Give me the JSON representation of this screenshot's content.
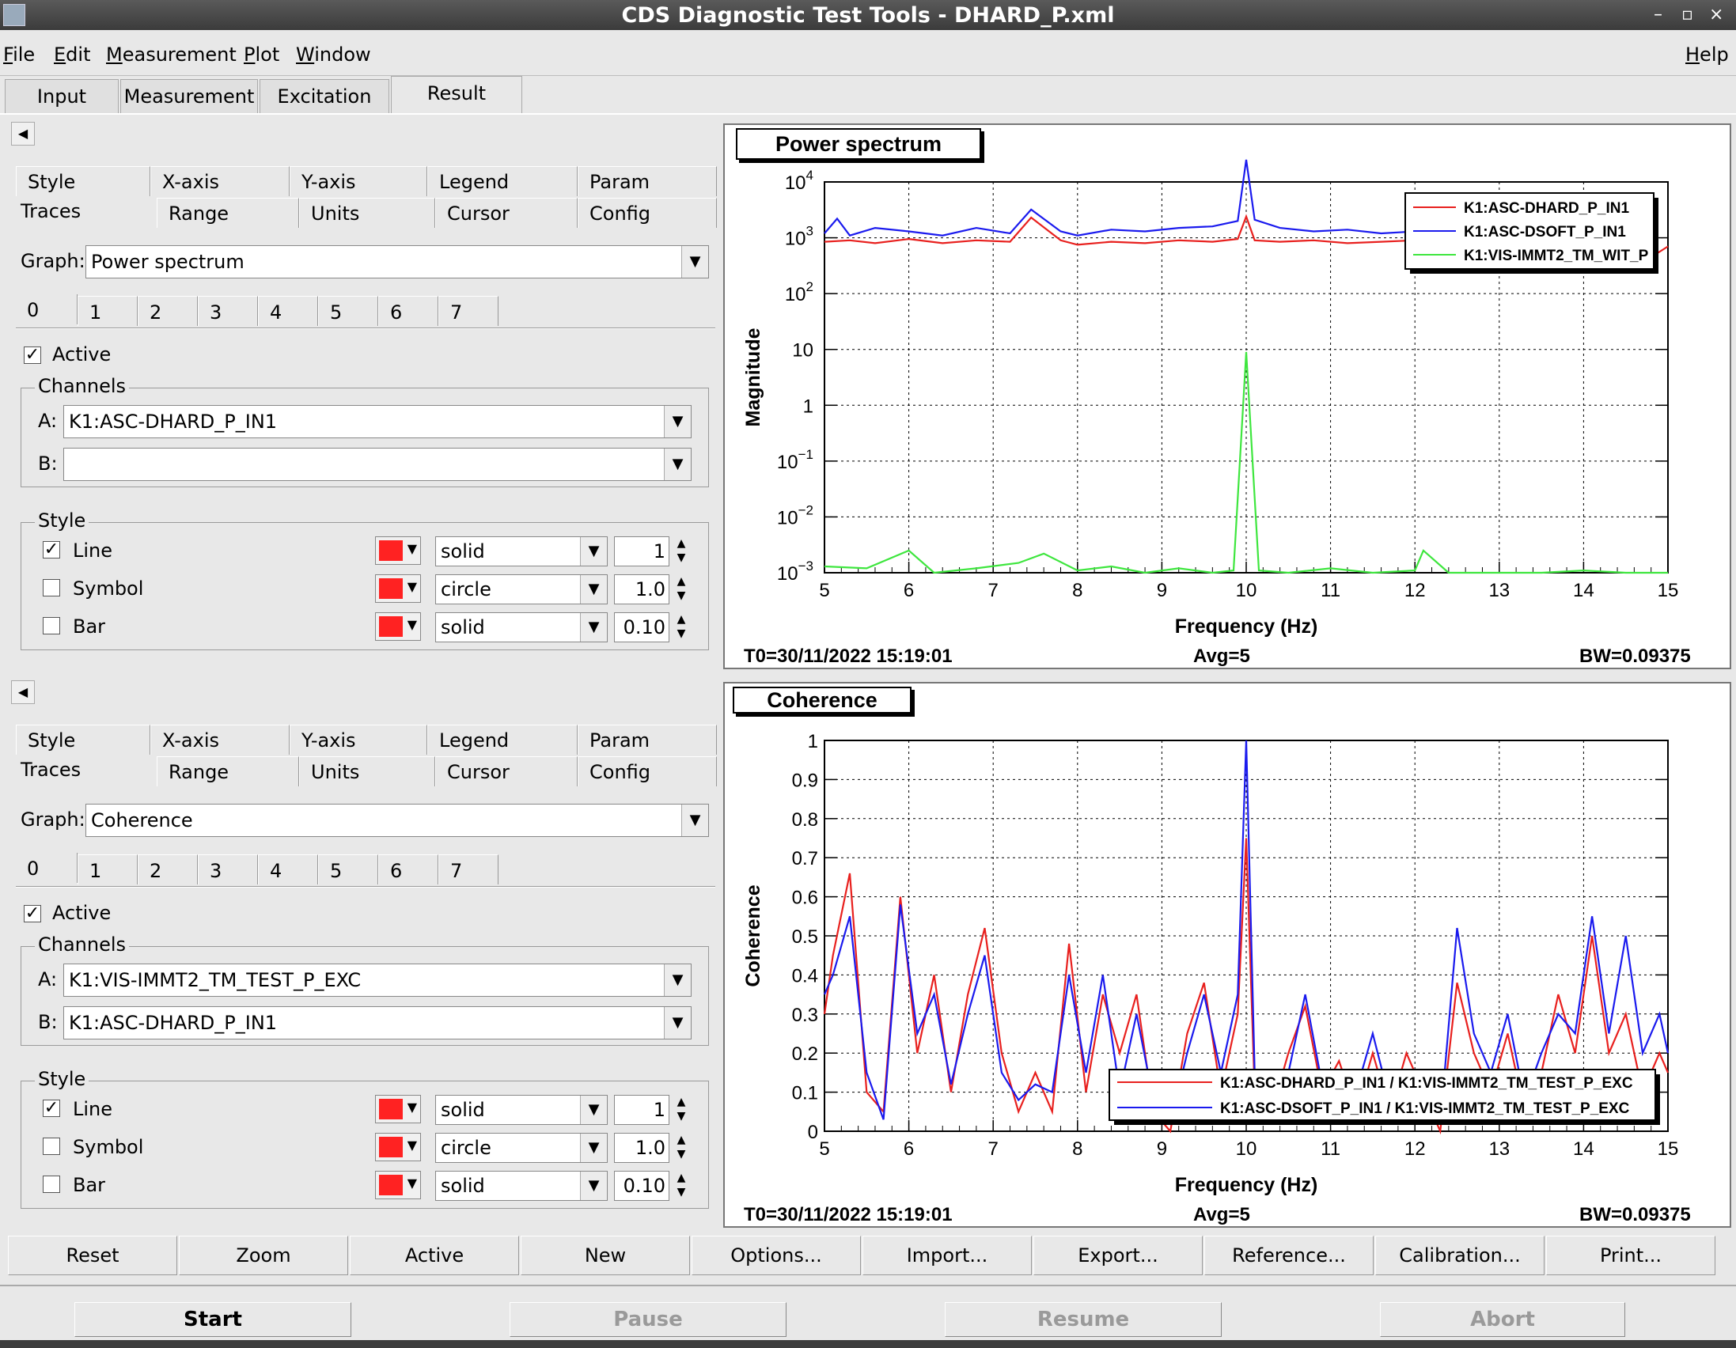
{
  "window": {
    "title": "CDS Diagnostic Test Tools - DHARD_P.xml",
    "controls": [
      "–",
      "▫",
      "×"
    ]
  },
  "menu": {
    "file": {
      "u": "F",
      "rest": "ile"
    },
    "edit": {
      "u": "E",
      "rest": "dit"
    },
    "measurement": {
      "u": "M",
      "rest": "easurement"
    },
    "plot": {
      "u": "P",
      "rest": "lot"
    },
    "window": {
      "u": "W",
      "rest": "indow"
    },
    "help": {
      "u": "H",
      "rest": "elp"
    }
  },
  "top_tabs": [
    "Input",
    "Measurement",
    "Excitation",
    "Result"
  ],
  "panels": [
    {
      "subtabs_row1": [
        "Style",
        "X-axis",
        "Y-axis",
        "Legend",
        "Param"
      ],
      "subtabs_row2": [
        "Traces",
        "Range",
        "Units",
        "Cursor",
        "Config"
      ],
      "graph_label": "Graph:",
      "graph_value": "Power spectrum",
      "trace_tabs": [
        "0",
        "1",
        "2",
        "3",
        "4",
        "5",
        "6",
        "7"
      ],
      "active_label": "Active",
      "channels_title": "Channels",
      "channel_a_label": "A:",
      "channel_a": "K1:ASC-DHARD_P_IN1",
      "channel_b_label": "B:",
      "channel_b": "",
      "style_title": "Style",
      "line_label": "Line",
      "line_style": "solid",
      "line_width": "1",
      "symbol_label": "Symbol",
      "symbol_style": "circle",
      "symbol_size": "1.0",
      "bar_label": "Bar",
      "bar_style": "solid",
      "bar_width": "0.10"
    },
    {
      "subtabs_row1": [
        "Style",
        "X-axis",
        "Y-axis",
        "Legend",
        "Param"
      ],
      "subtabs_row2": [
        "Traces",
        "Range",
        "Units",
        "Cursor",
        "Config"
      ],
      "graph_label": "Graph:",
      "graph_value": "Coherence",
      "trace_tabs": [
        "0",
        "1",
        "2",
        "3",
        "4",
        "5",
        "6",
        "7"
      ],
      "active_label": "Active",
      "channels_title": "Channels",
      "channel_a_label": "A:",
      "channel_a": "K1:VIS-IMMT2_TM_TEST_P_EXC",
      "channel_b_label": "B:",
      "channel_b": "K1:ASC-DHARD_P_IN1",
      "style_title": "Style",
      "line_label": "Line",
      "line_style": "solid",
      "line_width": "1",
      "symbol_label": "Symbol",
      "symbol_style": "circle",
      "symbol_size": "1.0",
      "bar_label": "Bar",
      "bar_style": "solid",
      "bar_width": "0.10"
    }
  ],
  "plots": [
    {
      "title": "Power spectrum",
      "footer_t0": "T0=30/11/2022 15:19:01",
      "footer_avg": "Avg=5",
      "footer_bw": "BW=0.09375"
    },
    {
      "title": "Coherence",
      "footer_t0": "T0=30/11/2022 15:19:01",
      "footer_avg": "Avg=5",
      "footer_bw": "BW=0.09375"
    }
  ],
  "chart_data": [
    {
      "type": "line",
      "title": "Power spectrum",
      "xlabel": "Frequency (Hz)",
      "ylabel": "Magnitude",
      "xlim": [
        5,
        15
      ],
      "ylim": [
        0.001,
        10000
      ],
      "yscale": "log",
      "grid": true,
      "legend_position": "top-right",
      "x_ticks": [
        "5",
        "6",
        "7",
        "8",
        "9",
        "10",
        "11",
        "12",
        "13",
        "14",
        "15"
      ],
      "y_ticks": [
        {
          "value": 10000,
          "base": "10",
          "exp": "4"
        },
        {
          "value": 1000,
          "base": "10",
          "exp": "3"
        },
        {
          "value": 100,
          "base": "10",
          "exp": "2"
        },
        {
          "value": 10,
          "base": "10",
          "exp": ""
        },
        {
          "value": 1,
          "base": "1",
          "exp": ""
        },
        {
          "value": 0.1,
          "base": "10",
          "exp": "−1"
        },
        {
          "value": 0.01,
          "base": "10",
          "exp": "−2"
        },
        {
          "value": 0.001,
          "base": "10",
          "exp": "−3"
        }
      ],
      "series": [
        {
          "name": "K1:ASC-DHARD_P_IN1",
          "color": "#e8201e",
          "x": [
            5,
            5.3,
            5.6,
            6,
            6.4,
            6.8,
            7.2,
            7.45,
            7.8,
            8,
            8.4,
            8.8,
            9.2,
            9.6,
            9.9,
            10,
            10.1,
            10.4,
            10.8,
            11.2,
            11.6,
            12,
            12.4,
            12.8,
            13.2,
            13.6,
            14,
            14.4,
            14.8,
            15
          ],
          "y": [
            850,
            900,
            800,
            950,
            800,
            900,
            850,
            2300,
            900,
            750,
            850,
            800,
            900,
            850,
            950,
            2400,
            900,
            850,
            900,
            800,
            850,
            900,
            800,
            850,
            900,
            800,
            500,
            500,
            450,
            700
          ]
        },
        {
          "name": "K1:ASC-DSOFT_P_IN1",
          "color": "#1a1aee",
          "x": [
            5,
            5.15,
            5.3,
            5.6,
            6,
            6.4,
            6.8,
            7.2,
            7.45,
            7.8,
            8,
            8.4,
            8.8,
            9.2,
            9.6,
            9.9,
            10,
            10.1,
            10.4,
            10.8,
            11.2,
            11.6,
            12,
            12.2
          ],
          "y": [
            1200,
            2200,
            1100,
            1500,
            1300,
            1100,
            1500,
            1200,
            3200,
            1300,
            1100,
            1400,
            1300,
            1500,
            1600,
            2000,
            25000,
            2100,
            1500,
            1300,
            1400,
            1200,
            1300,
            1200
          ]
        },
        {
          "name": "K1:VIS-IMMT2_TM_WIT_P",
          "color": "#3ee63e",
          "x": [
            5,
            5.5,
            6,
            6.3,
            6.8,
            7.3,
            7.6,
            8,
            8.4,
            8.8,
            9.2,
            9.6,
            9.85,
            10,
            10.15,
            10.5,
            11,
            11.5,
            12,
            12.1,
            12.4,
            13,
            13.5,
            14,
            14.5,
            15
          ],
          "y": [
            0.0013,
            0.0012,
            0.0025,
            0.001,
            0.0012,
            0.0015,
            0.0022,
            0.0011,
            0.0013,
            0.001,
            0.0012,
            0.001,
            0.0011,
            9,
            0.0011,
            0.001,
            0.0012,
            0.0009,
            0.0011,
            0.0025,
            0.001,
            0.0009,
            0.001,
            0.0011,
            0.0009,
            0.001
          ]
        }
      ]
    },
    {
      "type": "line",
      "title": "Coherence",
      "xlabel": "Frequency (Hz)",
      "ylabel": "Coherence",
      "xlim": [
        5,
        15
      ],
      "ylim": [
        0,
        1
      ],
      "grid": true,
      "legend_position": "bottom-right",
      "x_ticks": [
        "5",
        "6",
        "7",
        "8",
        "9",
        "10",
        "11",
        "12",
        "13",
        "14",
        "15"
      ],
      "y_ticks": [
        "0",
        "0.1",
        "0.2",
        "0.3",
        "0.4",
        "0.5",
        "0.6",
        "0.7",
        "0.8",
        "0.9",
        "1"
      ],
      "series": [
        {
          "name": "K1:ASC-DHARD_P_IN1 / K1:VIS-IMMT2_TM_TEST_P_EXC",
          "color": "#e8201e",
          "x": [
            5,
            5.1,
            5.3,
            5.5,
            5.7,
            5.9,
            6.1,
            6.3,
            6.5,
            6.7,
            6.9,
            7.1,
            7.3,
            7.5,
            7.7,
            7.9,
            8.1,
            8.3,
            8.5,
            8.7,
            8.9,
            9.1,
            9.3,
            9.5,
            9.7,
            9.9,
            10,
            10.1,
            10.3,
            10.5,
            10.7,
            10.9,
            11.1,
            11.3,
            11.5,
            11.7,
            11.9,
            12.1,
            12.3,
            12.5,
            12.7,
            12.9,
            13.1,
            13.3,
            13.5,
            13.7,
            13.9,
            14.1,
            14.3,
            14.5,
            14.7,
            14.9,
            15
          ],
          "y": [
            0.3,
            0.45,
            0.66,
            0.1,
            0.05,
            0.6,
            0.2,
            0.4,
            0.1,
            0.35,
            0.52,
            0.2,
            0.05,
            0.15,
            0.05,
            0.48,
            0.1,
            0.35,
            0.2,
            0.35,
            0.05,
            0.0,
            0.25,
            0.38,
            0.1,
            0.3,
            0.75,
            0.1,
            0.05,
            0.2,
            0.32,
            0.1,
            0.18,
            0.05,
            0.2,
            0.05,
            0.2,
            0.1,
            0.0,
            0.38,
            0.2,
            0.1,
            0.25,
            0.05,
            0.15,
            0.35,
            0.2,
            0.5,
            0.2,
            0.3,
            0.1,
            0.2,
            0.15
          ]
        },
        {
          "name": "K1:ASC-DSOFT_P_IN1 / K1:VIS-IMMT2_TM_TEST_P_EXC",
          "color": "#1a1aee",
          "x": [
            5,
            5.1,
            5.3,
            5.5,
            5.7,
            5.9,
            6.1,
            6.3,
            6.5,
            6.7,
            6.9,
            7.1,
            7.3,
            7.5,
            7.7,
            7.9,
            8.1,
            8.3,
            8.5,
            8.7,
            8.9,
            9.1,
            9.3,
            9.5,
            9.7,
            9.9,
            10,
            10.1,
            10.3,
            10.5,
            10.7,
            10.9,
            11.1,
            11.3,
            11.5,
            11.7,
            11.9,
            12.1,
            12.3,
            12.5,
            12.7,
            12.9,
            13.1,
            13.3,
            13.5,
            13.7,
            13.9,
            14.1,
            14.3,
            14.5,
            14.7,
            14.9,
            15
          ],
          "y": [
            0.35,
            0.4,
            0.55,
            0.15,
            0.03,
            0.58,
            0.25,
            0.35,
            0.12,
            0.3,
            0.45,
            0.15,
            0.08,
            0.12,
            0.1,
            0.4,
            0.15,
            0.4,
            0.1,
            0.3,
            0.08,
            0.02,
            0.2,
            0.35,
            0.15,
            0.35,
            1.0,
            0.15,
            0.08,
            0.15,
            0.35,
            0.12,
            0.15,
            0.1,
            0.25,
            0.08,
            0.15,
            0.15,
            0.02,
            0.52,
            0.25,
            0.15,
            0.3,
            0.08,
            0.2,
            0.3,
            0.25,
            0.55,
            0.25,
            0.5,
            0.2,
            0.3,
            0.2
          ]
        }
      ]
    }
  ],
  "buttons": [
    "Reset",
    "Zoom",
    "Active",
    "New",
    "Options...",
    "Import...",
    "Export...",
    "Reference...",
    "Calibration...",
    "Print..."
  ],
  "big_buttons": {
    "start": "Start",
    "pause": "Pause",
    "resume": "Resume",
    "abort": "Abort"
  }
}
